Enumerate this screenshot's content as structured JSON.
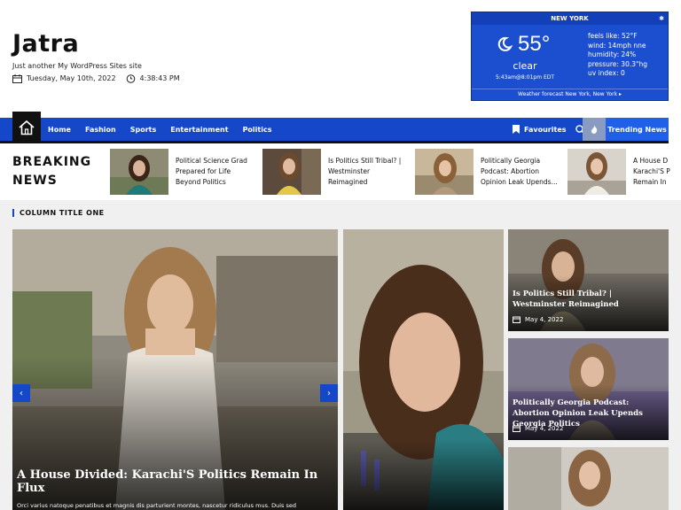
{
  "site": {
    "title": "Jatra",
    "description": "Just another My WordPress Sites site",
    "date": "Tuesday, May 10th, 2022",
    "time": "4:38:43 PM"
  },
  "weather": {
    "city": "NEW YORK",
    "temp": "55°",
    "condition": "clear",
    "sun": "5:43am@8:01pm EDT",
    "stats": [
      "feels like: 52°F",
      "wind: 14mph nne",
      "humidity: 24%",
      "pressure: 30.3\"hg",
      "uv index: 0"
    ],
    "footer": "Weather forecast New York, New York ▸"
  },
  "nav": {
    "items": [
      "Home",
      "Fashion",
      "Sports",
      "Entertainment",
      "Politics"
    ],
    "favourites": "Favourites",
    "trending": "Trending News"
  },
  "breaking": {
    "label_line1": "BREAKING",
    "label_line2": "NEWS",
    "items": [
      {
        "lines": [
          "Political Science Grad",
          "Prepared for Life",
          "Beyond Politics"
        ]
      },
      {
        "lines": [
          "Is Politics Still Tribal? |",
          "Westminster",
          "Reimagined"
        ]
      },
      {
        "lines": [
          "Politically Georgia",
          "Podcast: Abortion",
          "Opinion Leak Upends..."
        ]
      },
      {
        "lines": [
          "A House D",
          "Karachi'S P",
          "Remain In"
        ]
      }
    ]
  },
  "column": {
    "title": "COLUMN TITLE ONE",
    "featured": {
      "title": "A House Divided: Karachi'S Politics Remain In Flux",
      "excerpt": "Orci varius natoque penatibus et magnis dis parturient montes, nascetur ridiculus mus. Duis sed"
    },
    "side": [
      {
        "title": "Is Politics Still Tribal? | Westminster Reimagined",
        "date": "May 4, 2022"
      },
      {
        "title": "Politically Georgia Podcast: Abortion Opinion Leak Upends Georgia Politics",
        "date": "May 4, 2022"
      }
    ]
  },
  "colors": {
    "brand_blue": "#1548c9",
    "trending_blue": "#2060e8",
    "weather_blue": "#1c4fd0"
  }
}
